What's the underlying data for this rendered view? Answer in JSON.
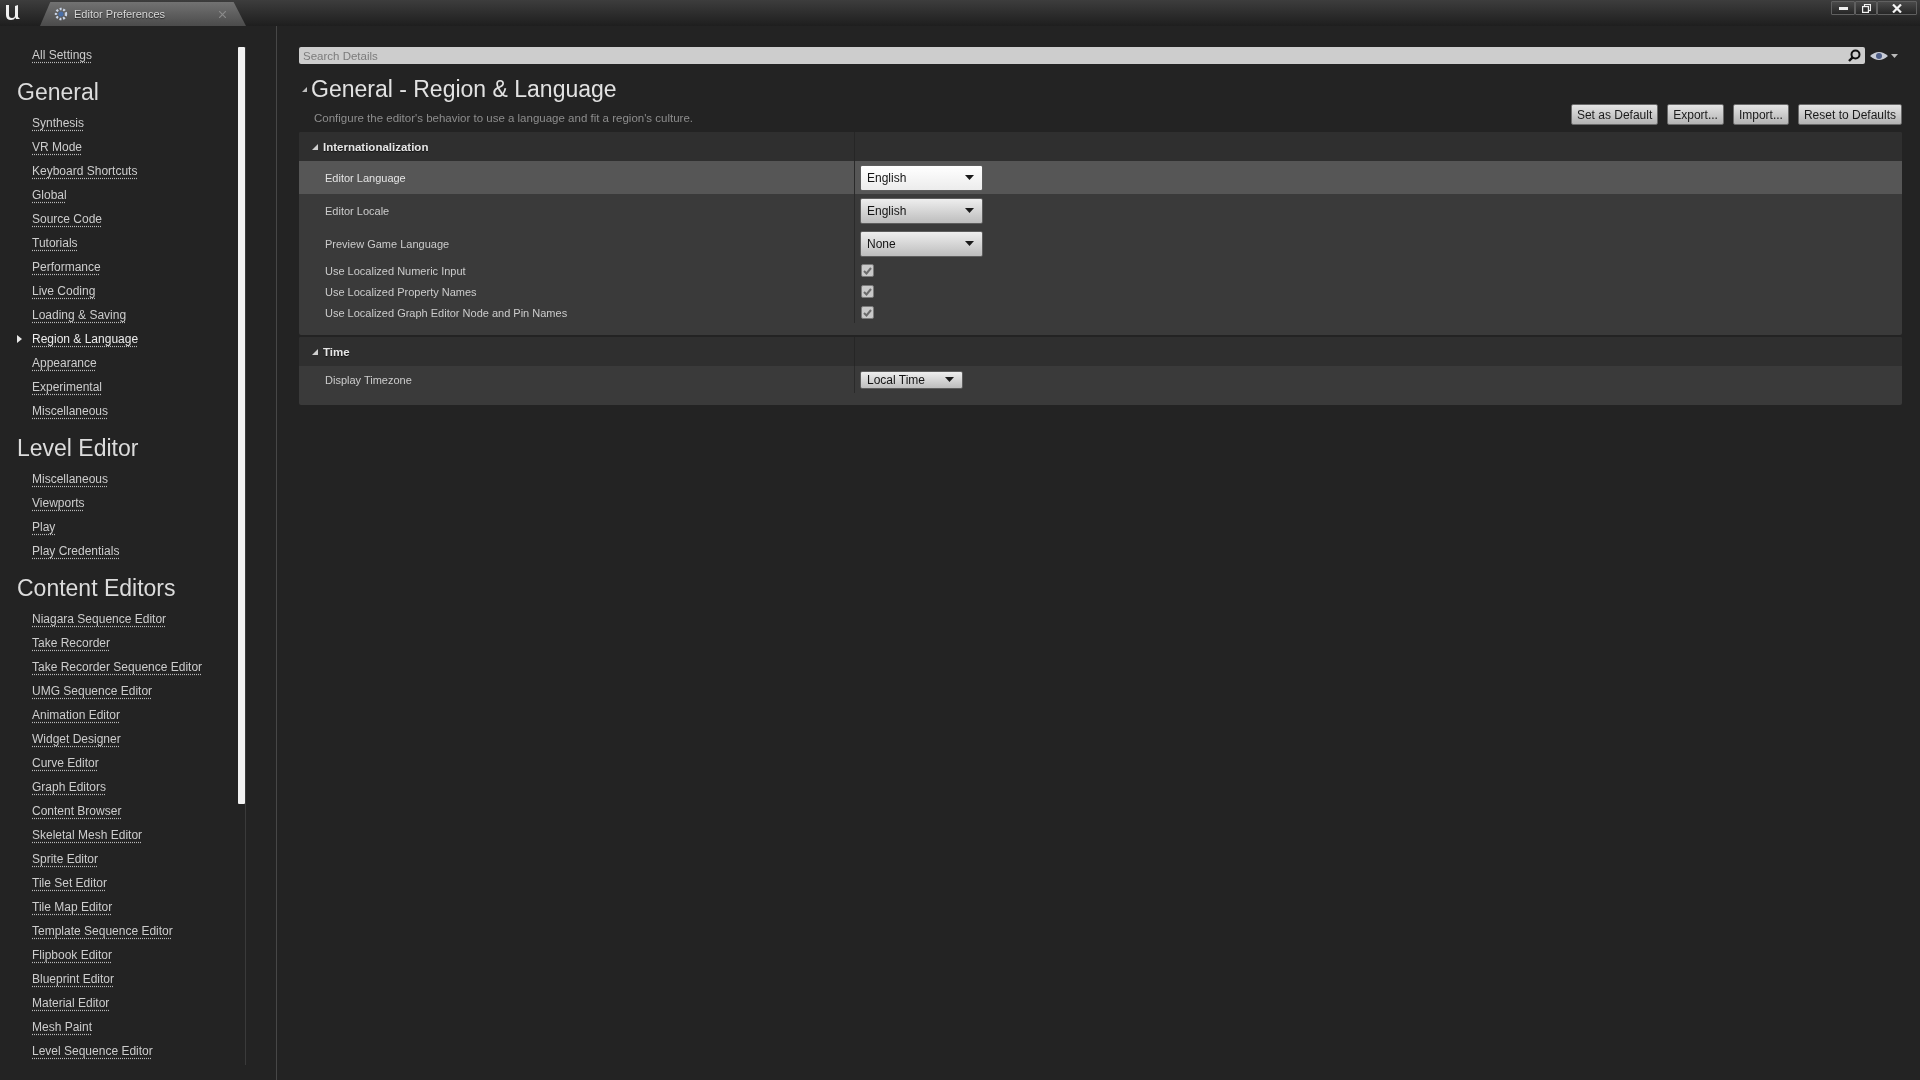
{
  "window": {
    "tab_title": "Editor Preferences"
  },
  "sidebar": {
    "all_settings": "All Settings",
    "groups": [
      {
        "title": "General",
        "items": [
          {
            "label": "Synthesis",
            "selected": false
          },
          {
            "label": "VR Mode",
            "selected": false
          },
          {
            "label": "Keyboard Shortcuts",
            "selected": false
          },
          {
            "label": "Global",
            "selected": false
          },
          {
            "label": "Source Code",
            "selected": false
          },
          {
            "label": "Tutorials",
            "selected": false
          },
          {
            "label": "Performance",
            "selected": false
          },
          {
            "label": "Live Coding",
            "selected": false
          },
          {
            "label": "Loading & Saving",
            "selected": false
          },
          {
            "label": "Region & Language",
            "selected": true
          },
          {
            "label": "Appearance",
            "selected": false
          },
          {
            "label": "Experimental",
            "selected": false
          },
          {
            "label": "Miscellaneous",
            "selected": false
          }
        ]
      },
      {
        "title": "Level Editor",
        "items": [
          {
            "label": "Miscellaneous",
            "selected": false
          },
          {
            "label": "Viewports",
            "selected": false
          },
          {
            "label": "Play",
            "selected": false
          },
          {
            "label": "Play Credentials",
            "selected": false
          }
        ]
      },
      {
        "title": "Content Editors",
        "items": [
          {
            "label": "Niagara Sequence Editor",
            "selected": false
          },
          {
            "label": "Take Recorder",
            "selected": false
          },
          {
            "label": "Take Recorder Sequence Editor",
            "selected": false
          },
          {
            "label": "UMG Sequence Editor",
            "selected": false
          },
          {
            "label": "Animation Editor",
            "selected": false
          },
          {
            "label": "Widget Designer",
            "selected": false
          },
          {
            "label": "Curve Editor",
            "selected": false
          },
          {
            "label": "Graph Editors",
            "selected": false
          },
          {
            "label": "Content Browser",
            "selected": false
          },
          {
            "label": "Skeletal Mesh Editor",
            "selected": false
          },
          {
            "label": "Sprite Editor",
            "selected": false
          },
          {
            "label": "Tile Set Editor",
            "selected": false
          },
          {
            "label": "Tile Map Editor",
            "selected": false
          },
          {
            "label": "Template Sequence Editor",
            "selected": false
          },
          {
            "label": "Flipbook Editor",
            "selected": false
          },
          {
            "label": "Blueprint Editor",
            "selected": false
          },
          {
            "label": "Material Editor",
            "selected": false
          },
          {
            "label": "Mesh Paint",
            "selected": false
          },
          {
            "label": "Level Sequence Editor",
            "selected": false
          }
        ]
      }
    ]
  },
  "details": {
    "search": {
      "placeholder": "Search Details"
    },
    "title": "General - Region & Language",
    "expanded": true,
    "description": "Configure the editor's behavior to use a language and fit a region's culture.",
    "buttons": [
      "Set as Default",
      "Export...",
      "Import...",
      "Reset to Defaults"
    ],
    "sections": [
      {
        "title": "Internationalization",
        "expanded": true,
        "rows": [
          {
            "kind": "picker",
            "label": "Editor Language",
            "value": "English",
            "hovered": true
          },
          {
            "kind": "picker",
            "label": "Editor Locale",
            "value": "English",
            "hovered": false
          },
          {
            "kind": "picker",
            "label": "Preview Game Language",
            "value": "None",
            "hovered": false
          },
          {
            "kind": "checkbox",
            "label": "Use Localized Numeric Input",
            "checked": true,
            "hovered": false
          },
          {
            "kind": "checkbox",
            "label": "Use Localized Property Names",
            "checked": true,
            "hovered": false
          },
          {
            "kind": "checkbox",
            "label": "Use Localized Graph Editor Node and Pin Names",
            "checked": true,
            "hovered": false
          }
        ]
      },
      {
        "title": "Time",
        "expanded": true,
        "rows": [
          {
            "kind": "enum",
            "label": "Display Timezone",
            "value": "Local Time",
            "hovered": false
          }
        ]
      }
    ]
  }
}
